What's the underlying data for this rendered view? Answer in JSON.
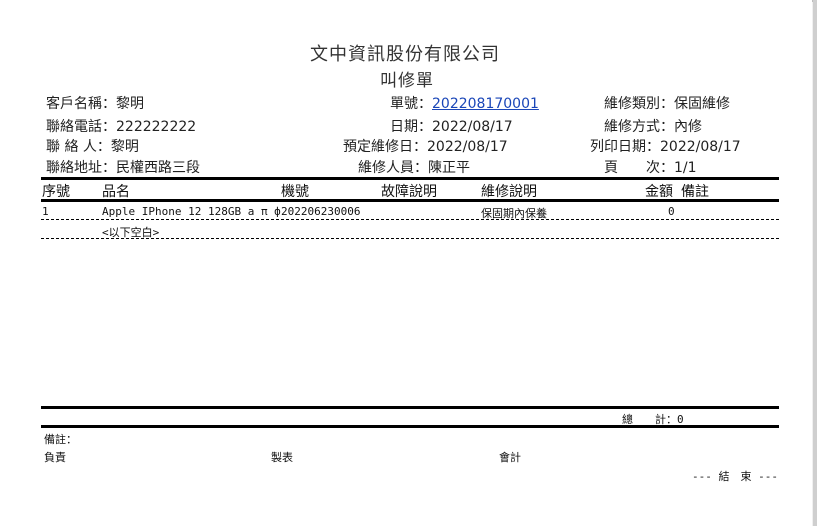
{
  "company": "文中資訊股份有限公司",
  "doc_title": "叫修單",
  "info": {
    "customer_label": "客戶名稱：",
    "customer": "黎明",
    "phone_label": "聯絡電話：",
    "phone": "222222222",
    "contact_label": "聯 絡 人：",
    "contact": "黎明",
    "address_label": "聯絡地址：",
    "address": "民權西路三段",
    "order_no_label": "單號：",
    "order_no": "202208170001",
    "date_label": "日期：",
    "date": "2022/08/17",
    "scheduled_label": "預定維修日：",
    "scheduled": "2022/08/17",
    "tech_label": "維修人員：",
    "tech": "陳正平",
    "repair_type_label": "維修類別：",
    "repair_type": "保固維修",
    "repair_method_label": "維修方式：",
    "repair_method": "內修",
    "print_date_label": "列印日期：",
    "print_date": "2022/08/17",
    "page_label": "頁　　次：",
    "page": "1/1"
  },
  "table": {
    "headers": [
      "序號",
      "品名",
      "機號",
      "故障說明",
      "維修說明",
      "金額",
      "備註"
    ],
    "rows": [
      {
        "seq": "1",
        "name": "Apple IPhone 12 128GB a π ф",
        "serial": "202206230006",
        "fault": "",
        "repair": "保固期內保養",
        "amount": "0",
        "note": ""
      }
    ],
    "blank_note": "<以下空白>"
  },
  "totals": {
    "label": "總　　計：",
    "value": "0"
  },
  "footer": {
    "remarks_label": "備註：",
    "responsible_label": "負責",
    "prepared_label": "製表",
    "accounting_label": "會計",
    "end_text": "--- 結　束 ---"
  }
}
